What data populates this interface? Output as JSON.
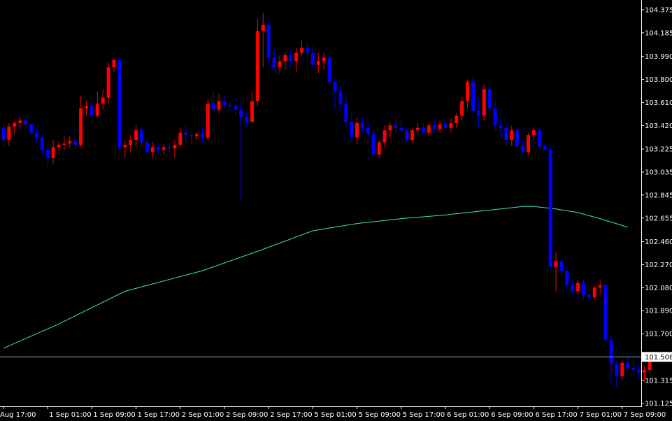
{
  "chart_data": {
    "type": "candlestick",
    "ylim": [
      101.1,
      104.45
    ],
    "y_ticks": [
      "104.375",
      "104.185",
      "103.990",
      "103.800",
      "103.610",
      "103.420",
      "103.225",
      "103.035",
      "102.845",
      "102.655",
      "102.460",
      "102.270",
      "102.080",
      "101.890",
      "101.700",
      "101.315",
      "101.125"
    ],
    "x_ticks": [
      {
        "label": "Aug 17:00",
        "bar": 0
      },
      {
        "label": "1 Sep 01:00",
        "bar": 8
      },
      {
        "label": "1 Sep 09:00",
        "bar": 16
      },
      {
        "label": "1 Sep 17:00",
        "bar": 24
      },
      {
        "label": "2 Sep 01:00",
        "bar": 32
      },
      {
        "label": "2 Sep 09:00",
        "bar": 40
      },
      {
        "label": "2 Sep 17:00",
        "bar": 48
      },
      {
        "label": "5 Sep 01:00",
        "bar": 56
      },
      {
        "label": "5 Sep 09:00",
        "bar": 64
      },
      {
        "label": "5 Sep 17:00",
        "bar": 72
      },
      {
        "label": "6 Sep 01:00",
        "bar": 80
      },
      {
        "label": "6 Sep 09:00",
        "bar": 88
      },
      {
        "label": "6 Sep 17:00",
        "bar": 96
      },
      {
        "label": "7 Sep 01:00",
        "bar": 104
      },
      {
        "label": "7 Sep 09:00",
        "bar": 112
      }
    ],
    "current_price": {
      "value": 101.508,
      "label": "101.508"
    },
    "moving_average": {
      "points": [
        [
          0,
          101.58
        ],
        [
          10,
          101.78
        ],
        [
          22,
          102.05
        ],
        [
          36,
          102.22
        ],
        [
          46,
          102.38
        ],
        [
          56,
          102.55
        ],
        [
          64,
          102.61
        ],
        [
          72,
          102.65
        ],
        [
          80,
          102.68
        ],
        [
          88,
          102.72
        ],
        [
          94,
          102.75
        ],
        [
          96,
          102.75
        ],
        [
          100,
          102.73
        ],
        [
          104,
          102.7
        ],
        [
          108,
          102.65
        ],
        [
          113,
          102.58
        ]
      ]
    },
    "colors": {
      "up": "#ff0000",
      "down": "#0000ff",
      "ma": "#40e0d0",
      "price_line": "#8fb0c8",
      "axis": "#ffffff",
      "background": "#000000"
    },
    "candles": [
      [
        103.4,
        103.44,
        103.24,
        103.3
      ],
      [
        103.3,
        103.44,
        103.25,
        103.41
      ],
      [
        103.41,
        103.46,
        103.35,
        103.44
      ],
      [
        103.44,
        103.49,
        103.39,
        103.46
      ],
      [
        103.46,
        103.48,
        103.4,
        103.43
      ],
      [
        103.43,
        103.44,
        103.32,
        103.36
      ],
      [
        103.36,
        103.4,
        103.28,
        103.32
      ],
      [
        103.32,
        103.35,
        103.18,
        103.22
      ],
      [
        103.22,
        103.26,
        103.08,
        103.15
      ],
      [
        103.15,
        103.3,
        103.1,
        103.24
      ],
      [
        103.24,
        103.29,
        103.2,
        103.26
      ],
      [
        103.26,
        103.33,
        103.22,
        103.27
      ],
      [
        103.27,
        103.33,
        103.23,
        103.29
      ],
      [
        103.29,
        103.34,
        103.22,
        103.26
      ],
      [
        103.26,
        103.66,
        103.24,
        103.56
      ],
      [
        103.56,
        103.62,
        103.5,
        103.58
      ],
      [
        103.58,
        103.64,
        103.48,
        103.5
      ],
      [
        103.5,
        103.7,
        103.48,
        103.6
      ],
      [
        103.6,
        103.72,
        103.55,
        103.65
      ],
      [
        103.65,
        103.94,
        103.6,
        103.9
      ],
      [
        103.9,
        103.98,
        103.86,
        103.96
      ],
      [
        103.96,
        103.98,
        103.15,
        103.24
      ],
      [
        103.24,
        103.3,
        103.15,
        103.26
      ],
      [
        103.26,
        103.34,
        103.2,
        103.3
      ],
      [
        103.3,
        103.42,
        103.25,
        103.38
      ],
      [
        103.38,
        103.4,
        103.24,
        103.28
      ],
      [
        103.28,
        103.32,
        103.18,
        103.2
      ],
      [
        103.2,
        103.28,
        103.16,
        103.24
      ],
      [
        103.24,
        103.27,
        103.18,
        103.22
      ],
      [
        103.22,
        103.27,
        103.18,
        103.24
      ],
      [
        103.24,
        103.28,
        103.2,
        103.23
      ],
      [
        103.23,
        103.3,
        103.15,
        103.26
      ],
      [
        103.26,
        103.4,
        103.24,
        103.36
      ],
      [
        103.36,
        103.42,
        103.28,
        103.34
      ],
      [
        103.34,
        103.37,
        103.26,
        103.33
      ],
      [
        103.33,
        103.36,
        103.3,
        103.35
      ],
      [
        103.35,
        103.4,
        103.28,
        103.32
      ],
      [
        103.32,
        103.64,
        103.3,
        103.6
      ],
      [
        103.6,
        103.7,
        103.52,
        103.55
      ],
      [
        103.55,
        103.68,
        103.52,
        103.62
      ],
      [
        103.62,
        103.66,
        103.56,
        103.59
      ],
      [
        103.59,
        103.62,
        103.54,
        103.58
      ],
      [
        103.58,
        103.6,
        103.5,
        103.55
      ],
      [
        103.55,
        103.62,
        102.8,
        103.49
      ],
      [
        103.49,
        103.52,
        103.42,
        103.45
      ],
      [
        103.45,
        103.7,
        103.44,
        103.62
      ],
      [
        103.62,
        104.3,
        103.58,
        104.2
      ],
      [
        104.2,
        104.35,
        103.9,
        104.25
      ],
      [
        104.25,
        104.3,
        103.9,
        103.98
      ],
      [
        103.98,
        104.05,
        103.86,
        103.9
      ],
      [
        103.9,
        104.0,
        103.85,
        103.95
      ],
      [
        103.95,
        104.02,
        103.88,
        104.0
      ],
      [
        104.0,
        104.05,
        103.9,
        103.95
      ],
      [
        103.95,
        104.06,
        103.86,
        104.02
      ],
      [
        104.02,
        104.12,
        104.0,
        104.06
      ],
      [
        104.06,
        104.1,
        103.98,
        104.02
      ],
      [
        104.02,
        104.08,
        103.9,
        103.92
      ],
      [
        103.92,
        104.02,
        103.85,
        103.95
      ],
      [
        103.95,
        104.02,
        103.88,
        103.98
      ],
      [
        103.98,
        104.0,
        103.75,
        103.78
      ],
      [
        103.78,
        103.82,
        103.55,
        103.7
      ],
      [
        103.7,
        103.75,
        103.55,
        103.6
      ],
      [
        103.6,
        103.66,
        103.4,
        103.45
      ],
      [
        103.45,
        103.52,
        103.28,
        103.32
      ],
      [
        103.32,
        103.48,
        103.26,
        103.44
      ],
      [
        103.44,
        103.48,
        103.36,
        103.4
      ],
      [
        103.4,
        103.44,
        103.32,
        103.35
      ],
      [
        103.35,
        103.38,
        103.15,
        103.18
      ],
      [
        103.18,
        103.3,
        103.15,
        103.28
      ],
      [
        103.28,
        103.42,
        103.24,
        103.38
      ],
      [
        103.38,
        103.44,
        103.32,
        103.42
      ],
      [
        103.42,
        103.48,
        103.36,
        103.4
      ],
      [
        103.4,
        103.46,
        103.36,
        103.38
      ],
      [
        103.38,
        103.4,
        103.28,
        103.3
      ],
      [
        103.3,
        103.4,
        103.28,
        103.38
      ],
      [
        103.38,
        103.44,
        103.34,
        103.4
      ],
      [
        103.4,
        103.44,
        103.34,
        103.36
      ],
      [
        103.36,
        103.45,
        103.33,
        103.42
      ],
      [
        103.42,
        103.46,
        103.36,
        103.39
      ],
      [
        103.39,
        103.46,
        103.36,
        103.43
      ],
      [
        103.43,
        103.46,
        103.38,
        103.4
      ],
      [
        103.4,
        103.48,
        103.36,
        103.44
      ],
      [
        103.44,
        103.52,
        103.4,
        103.5
      ],
      [
        103.5,
        103.66,
        103.46,
        103.62
      ],
      [
        103.62,
        103.8,
        103.56,
        103.78
      ],
      [
        103.78,
        103.83,
        103.52,
        103.54
      ],
      [
        103.54,
        103.65,
        103.4,
        103.5
      ],
      [
        103.5,
        103.76,
        103.46,
        103.72
      ],
      [
        103.72,
        103.78,
        103.52,
        103.56
      ],
      [
        103.56,
        103.62,
        103.38,
        103.42
      ],
      [
        103.42,
        103.48,
        103.34,
        103.4
      ],
      [
        103.4,
        103.43,
        103.25,
        103.3
      ],
      [
        103.3,
        103.42,
        103.25,
        103.38
      ],
      [
        103.38,
        103.4,
        103.22,
        103.25
      ],
      [
        103.25,
        103.3,
        103.18,
        103.2
      ],
      [
        103.2,
        103.36,
        103.18,
        103.34
      ],
      [
        103.34,
        103.41,
        103.3,
        103.38
      ],
      [
        103.38,
        103.4,
        103.22,
        103.25
      ],
      [
        103.25,
        103.28,
        103.24,
        103.22
      ],
      [
        103.22,
        103.24,
        102.26,
        102.25
      ],
      [
        102.25,
        102.38,
        102.05,
        102.3
      ],
      [
        102.3,
        102.33,
        102.18,
        102.22
      ],
      [
        102.22,
        102.25,
        102.08,
        102.1
      ],
      [
        102.1,
        102.14,
        102.02,
        102.05
      ],
      [
        102.05,
        102.14,
        102.02,
        102.12
      ],
      [
        102.12,
        102.14,
        101.98,
        102.02
      ],
      [
        102.02,
        102.08,
        101.96,
        102.0
      ],
      [
        102.0,
        102.1,
        101.98,
        102.08
      ],
      [
        102.08,
        102.15,
        102.02,
        102.1
      ],
      [
        102.1,
        102.14,
        101.62,
        101.65
      ],
      [
        101.65,
        101.68,
        101.28,
        101.45
      ],
      [
        101.45,
        101.48,
        101.25,
        101.35
      ],
      [
        101.35,
        101.48,
        101.32,
        101.46
      ],
      [
        101.46,
        101.5,
        101.4,
        101.42
      ],
      [
        101.42,
        101.47,
        101.36,
        101.4
      ],
      [
        101.4,
        101.45,
        101.34,
        101.38
      ],
      [
        101.38,
        101.43,
        101.3,
        101.4
      ],
      [
        101.4,
        101.53,
        101.37,
        101.48
      ]
    ]
  }
}
